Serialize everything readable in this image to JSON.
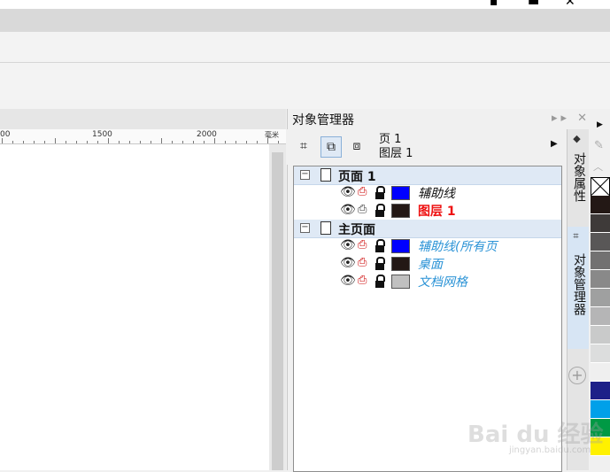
{
  "window_controls": {
    "minimize": "▪",
    "restore": "▬",
    "close": "✕"
  },
  "ruler": {
    "labels": [
      "00",
      "1500",
      "2000",
      "毫米"
    ]
  },
  "docker": {
    "title": "对象管理器",
    "controls": "▸▸ ✕",
    "page_info": {
      "line1": "页 1",
      "line2": "图层 1"
    }
  },
  "tree": {
    "page1": {
      "label": "页面 1"
    },
    "page1_layers": [
      {
        "name": "辅助线",
        "color": "#0000ff",
        "style": "normal"
      },
      {
        "name": "图层 1",
        "color": "#231815",
        "style": "active"
      }
    ],
    "master": {
      "label": "主页面"
    },
    "master_layers": [
      {
        "name": "辅助线(所有页",
        "color": "#0000ff"
      },
      {
        "name": "桌面",
        "color": "#231815"
      },
      {
        "name": "文档网格",
        "color": "#c0c0c0"
      }
    ]
  },
  "right_tabs": {
    "object_properties": "对象属性",
    "object_manager": "对象管理器"
  },
  "palette": {
    "colors": [
      "#231815",
      "#3e3a39",
      "#595757",
      "#727171",
      "#898989",
      "#9fa0a0",
      "#b5b5b6",
      "#c9caca",
      "#dcdddd",
      "#efefef",
      "#1d2088",
      "#00a0e9",
      "#009944",
      "#fff100"
    ]
  },
  "watermark": {
    "main": "Bai du 经验",
    "sub": "jingyan.baidu.com"
  }
}
